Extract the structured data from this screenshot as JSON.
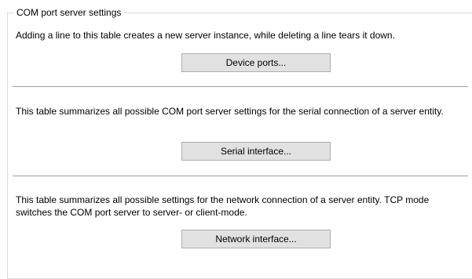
{
  "group": {
    "title": "COM port server settings"
  },
  "sections": [
    {
      "description": "Adding a line to this table creates a new server instance, while deleting a line tears it down.",
      "button_label": "Device ports..."
    },
    {
      "description": "This table summarizes all possible COM port server settings for the serial connection of a server entity.",
      "button_label": "Serial interface..."
    },
    {
      "description": "This table summarizes all possible settings for the network connection of a server entity. TCP mode switches the COM port server to server- or client-mode.",
      "button_label": "Network interface..."
    }
  ]
}
